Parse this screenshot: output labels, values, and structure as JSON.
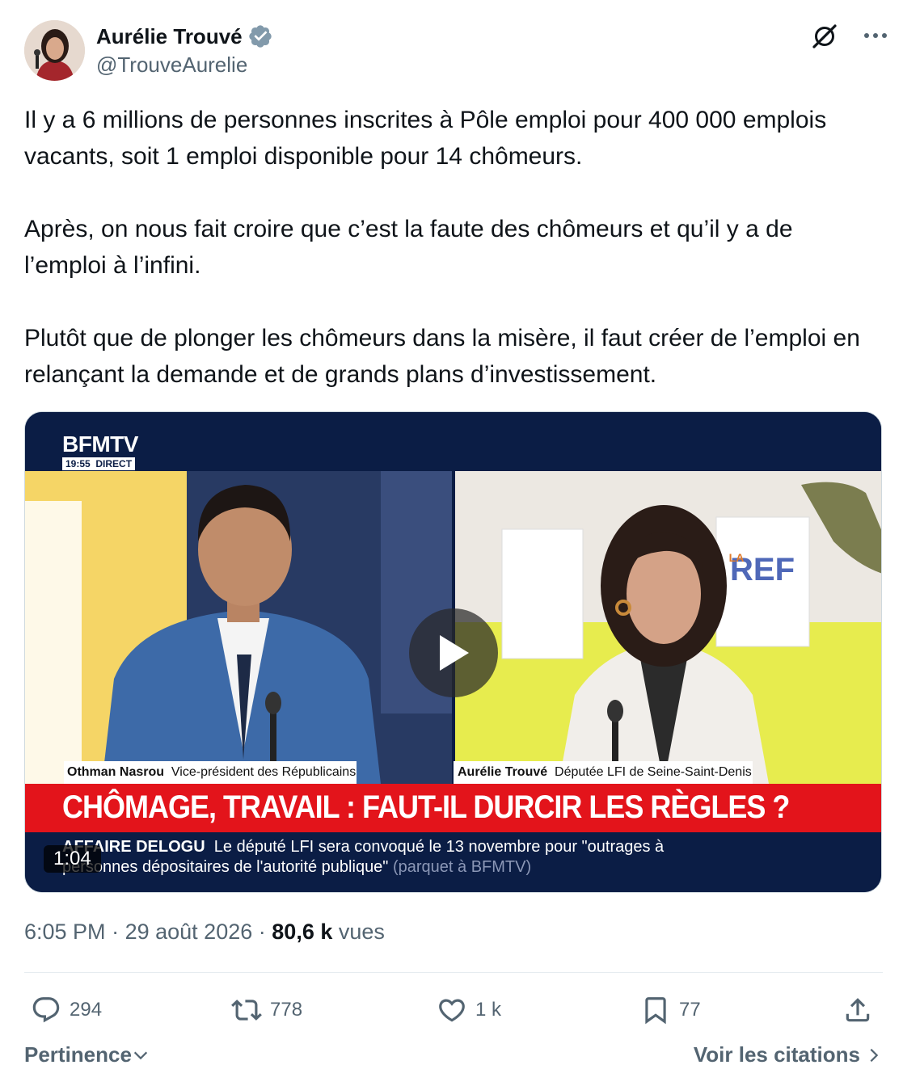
{
  "author": {
    "display_name": "Aurélie Trouvé",
    "handle": "@TrouveAurelie",
    "verified": true
  },
  "tweet": {
    "paragraphs": [
      "Il y a 6 millions de personnes inscrites à Pôle emploi pour 400 000 emplois vacants, soit 1 emploi disponible pour 14 chômeurs.",
      "Après, on nous fait croire que c’est la faute des chômeurs et qu’il y a de l’emploi à l’infini.",
      "Plutôt que de plonger les chômeurs dans la misère, il faut créer de l’emploi en relançant la demande et de grands plans d’investissement."
    ]
  },
  "media": {
    "duration": "1:04",
    "channel_logo": "BFMTV",
    "channel_time": "19:55",
    "channel_live": "DIRECT",
    "left_guest_name": "Othman Nasrou",
    "left_guest_role": "Vice-président des Républicains",
    "right_guest_name": "Aurélie Trouvé",
    "right_guest_role": "Députée LFI de Seine-Saint-Denis",
    "headline": "CHÔMAGE, TRAVAIL : FAUT-IL DURCIR LES RÈGLES ?",
    "ticker_label": "AFFAIRE DELOGU",
    "ticker_line1": "Le député LFI sera convoqué le 13 novembre pour \"outrages à",
    "ticker_line2": "personnes dépositaires de l'autorité publique\"",
    "ticker_source": "(parquet à BFMTV)",
    "backdrop_sign": "REF",
    "backdrop_sign_prefix": "LA"
  },
  "meta": {
    "time": "6:05 PM",
    "separator": "·",
    "date": "29 août 2026",
    "views_count": "80,6 k",
    "views_label": "vues"
  },
  "actions": {
    "replies": "294",
    "reposts": "778",
    "likes": "1 k",
    "bookmarks": "77"
  },
  "footer": {
    "sort_label": "Pertinence",
    "quotes_label": "Voir les citations"
  },
  "colors": {
    "verified_blue": "#829aab",
    "secondary_text": "#536471",
    "primary_text": "#0f1419",
    "bfm_red": "#e3141b",
    "bfm_navy": "#0b1d45"
  },
  "icons": {
    "grok": "grok-icon",
    "more": "more-icon",
    "reply": "reply-icon",
    "repost": "repost-icon",
    "like": "like-icon",
    "bookmark": "bookmark-icon",
    "share": "share-icon",
    "play": "play-icon",
    "chevron_down": "chevron-down-icon",
    "chevron_right": "chevron-right-icon"
  }
}
